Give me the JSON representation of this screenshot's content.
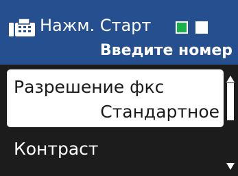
{
  "header": {
    "icon": "fax-icon",
    "status": "Нажм. Старт",
    "prompt": "Введите номер",
    "indicators": [
      {
        "name": "green",
        "color": "#19b24a"
      },
      {
        "name": "white",
        "color": "#ffffff"
      }
    ]
  },
  "menu": {
    "items": [
      {
        "label": "Разрешение фкс",
        "value": "Стандартное",
        "selected": true
      },
      {
        "label": "Контраст",
        "selected": false
      }
    ]
  },
  "colors": {
    "header_bg": "#264f8f",
    "screen_bg": "#1c1c1c",
    "selected_bg": "#ffffff"
  }
}
